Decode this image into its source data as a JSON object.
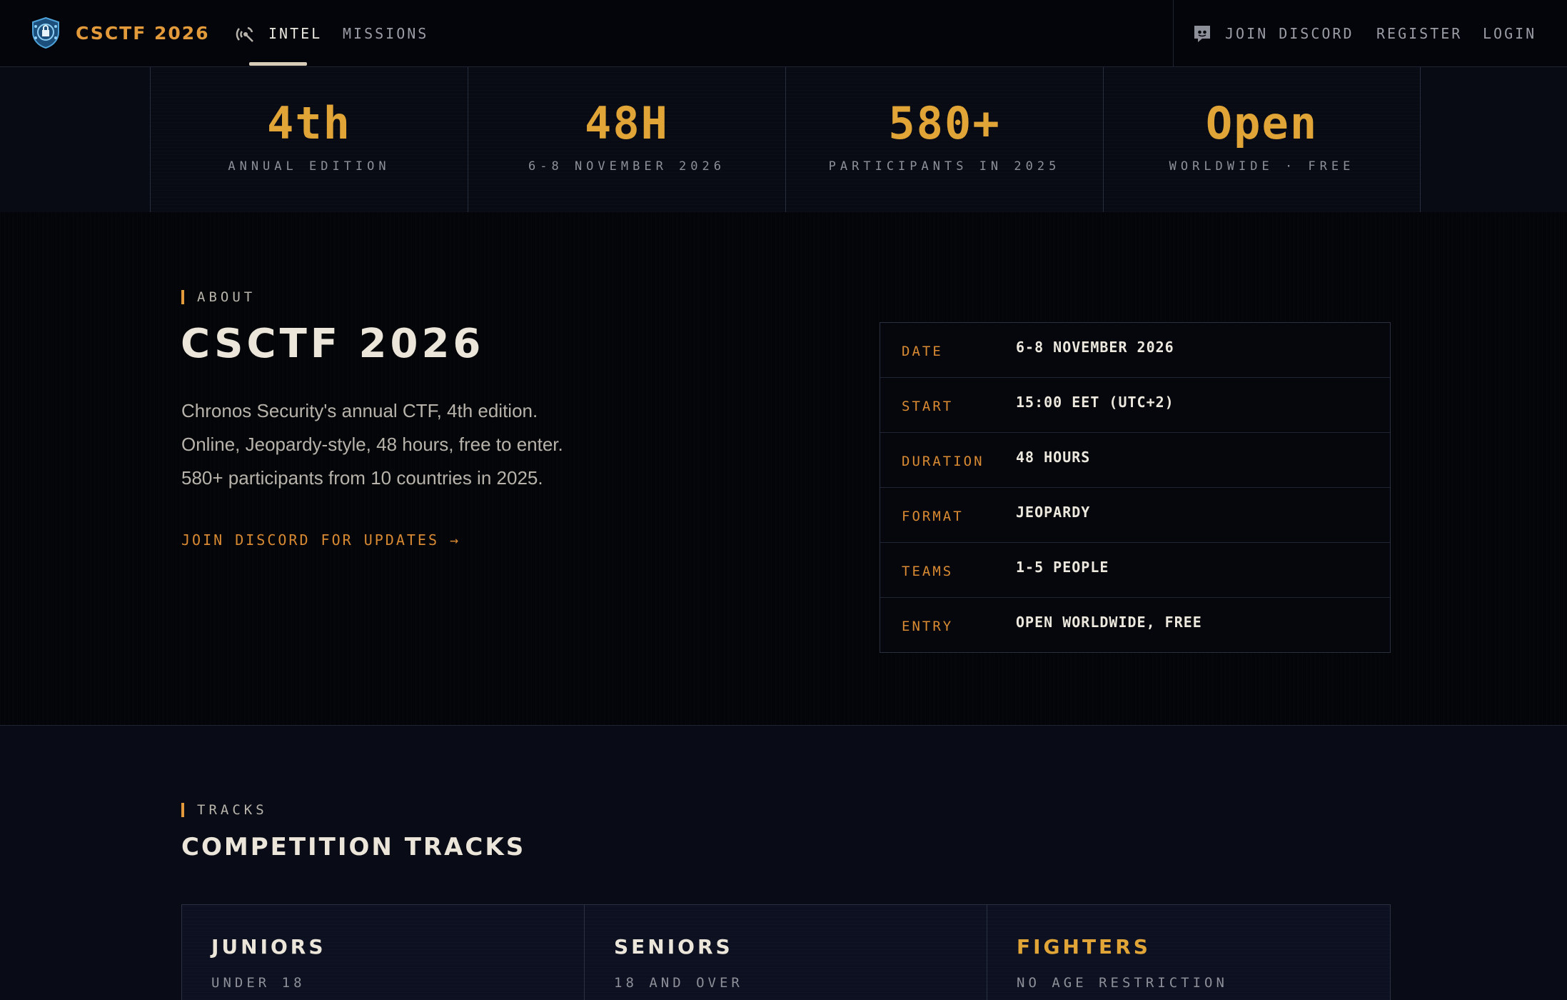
{
  "nav": {
    "brand": "CSCTF 2026",
    "tabs": [
      {
        "label": "INTEL",
        "active": true,
        "icon": "radar-icon"
      },
      {
        "label": "MISSIONS",
        "active": false
      }
    ],
    "actions": [
      {
        "label": "JOIN DISCORD",
        "icon": "discord-icon"
      },
      {
        "label": "REGISTER"
      },
      {
        "label": "LOGIN"
      }
    ]
  },
  "stats": [
    {
      "value": "4th",
      "label": "ANNUAL EDITION"
    },
    {
      "value": "48H",
      "label": "6-8 NOVEMBER 2026"
    },
    {
      "value": "580+",
      "label": "PARTICIPANTS IN 2025"
    },
    {
      "value": "Open",
      "label": "WORLDWIDE · FREE"
    }
  ],
  "about": {
    "kicker": "ABOUT",
    "title": "CSCTF 2026",
    "lines": [
      "Chronos Security's annual CTF, 4th edition.",
      "Online, Jeopardy-style, 48 hours, free to enter.",
      "580+ participants from 10 countries in 2025."
    ],
    "link": "JOIN DISCORD FOR UPDATES →",
    "info": [
      {
        "key": "DATE",
        "value": "6-8 NOVEMBER 2026"
      },
      {
        "key": "START",
        "value": "15:00 EET (UTC+2)"
      },
      {
        "key": "DURATION",
        "value": "48 HOURS"
      },
      {
        "key": "FORMAT",
        "value": "JEOPARDY"
      },
      {
        "key": "TEAMS",
        "value": "1-5 PEOPLE"
      },
      {
        "key": "ENTRY",
        "value": "OPEN WORLDWIDE, FREE"
      }
    ]
  },
  "tracks": {
    "kicker": "TRACKS",
    "title": "COMPETITION TRACKS",
    "items": [
      {
        "name": "JUNIORS",
        "sub": "UNDER 18"
      },
      {
        "name": "SENIORS",
        "sub": "18 AND OVER"
      },
      {
        "name": "FIGHTERS",
        "sub": "NO AGE RESTRICTION"
      }
    ]
  },
  "colors": {
    "accent": "#e0a437",
    "accent_orange": "#d98a32",
    "background": "#04060a",
    "text": "#ece6da"
  }
}
